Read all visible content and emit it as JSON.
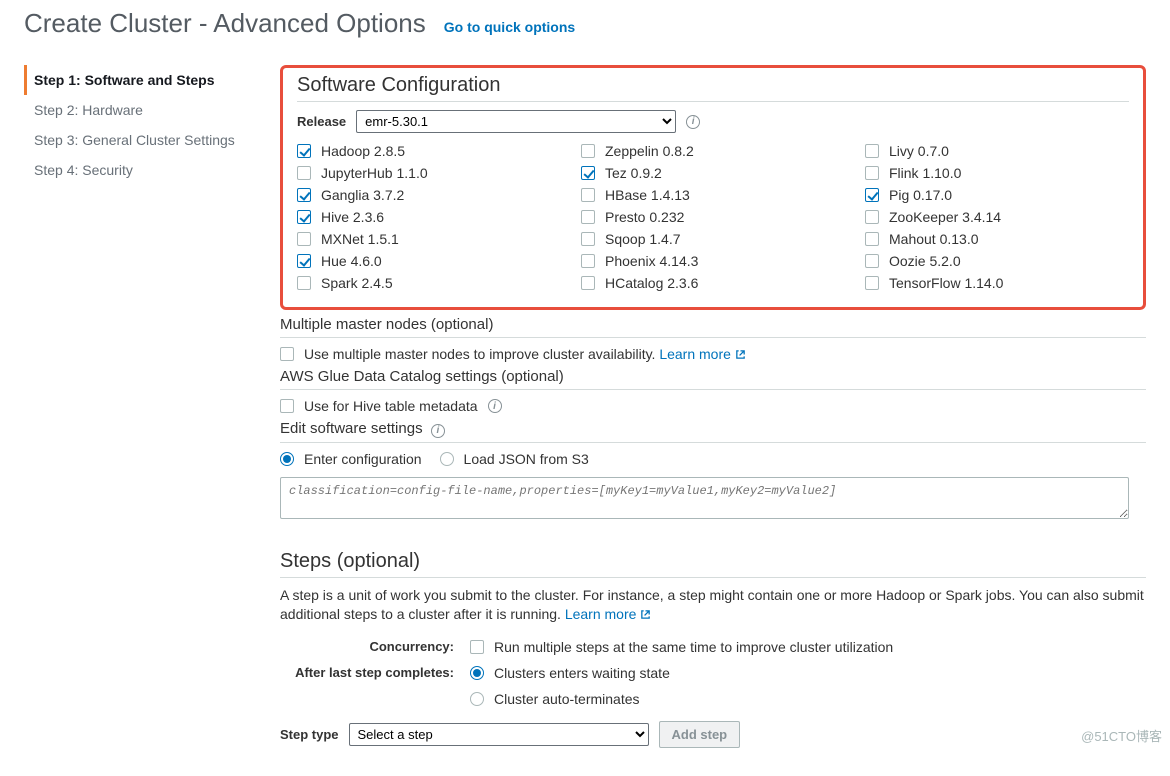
{
  "header": {
    "title": "Create Cluster - Advanced Options",
    "quick_link": "Go to quick options"
  },
  "sidebar": {
    "steps": [
      "Step 1: Software and Steps",
      "Step 2: Hardware",
      "Step 3: General Cluster Settings",
      "Step 4: Security"
    ]
  },
  "software": {
    "heading": "Software Configuration",
    "release_label": "Release",
    "release_value": "emr-5.30.1",
    "columns": [
      [
        {
          "label": "Hadoop 2.8.5",
          "checked": true
        },
        {
          "label": "JupyterHub 1.1.0",
          "checked": false
        },
        {
          "label": "Ganglia 3.7.2",
          "checked": true
        },
        {
          "label": "Hive 2.3.6",
          "checked": true
        },
        {
          "label": "MXNet 1.5.1",
          "checked": false
        },
        {
          "label": "Hue 4.6.0",
          "checked": true
        },
        {
          "label": "Spark 2.4.5",
          "checked": false
        }
      ],
      [
        {
          "label": "Zeppelin 0.8.2",
          "checked": false
        },
        {
          "label": "Tez 0.9.2",
          "checked": true
        },
        {
          "label": "HBase 1.4.13",
          "checked": false
        },
        {
          "label": "Presto 0.232",
          "checked": false
        },
        {
          "label": "Sqoop 1.4.7",
          "checked": false
        },
        {
          "label": "Phoenix 4.14.3",
          "checked": false
        },
        {
          "label": "HCatalog 2.3.6",
          "checked": false
        }
      ],
      [
        {
          "label": "Livy 0.7.0",
          "checked": false
        },
        {
          "label": "Flink 1.10.0",
          "checked": false
        },
        {
          "label": "Pig 0.17.0",
          "checked": true
        },
        {
          "label": "ZooKeeper 3.4.14",
          "checked": false
        },
        {
          "label": "Mahout 0.13.0",
          "checked": false
        },
        {
          "label": "Oozie 5.2.0",
          "checked": false
        },
        {
          "label": "TensorFlow 1.14.0",
          "checked": false
        }
      ]
    ]
  },
  "multi_master": {
    "heading": "Multiple master nodes (optional)",
    "checkbox_label": "Use multiple master nodes to improve cluster availability.",
    "learn_more": "Learn more"
  },
  "glue": {
    "heading": "AWS Glue Data Catalog settings (optional)",
    "checkbox_label": "Use for Hive table metadata"
  },
  "edit_settings": {
    "heading": "Edit software settings",
    "radio_enter": "Enter configuration",
    "radio_load": "Load JSON from S3",
    "placeholder": "classification=config-file-name,properties=[myKey1=myValue1,myKey2=myValue2]"
  },
  "steps_section": {
    "heading": "Steps (optional)",
    "desc_before": "A step is a unit of work you submit to the cluster. For instance, a step might contain one or more Hadoop or Spark jobs. You can also submit additional steps to a cluster after it is running.",
    "learn_more": "Learn more",
    "concurrency_label": "Concurrency:",
    "concurrency_text": "Run multiple steps at the same time to improve cluster utilization",
    "after_last_label": "After last step completes:",
    "after_opt1": "Clusters enters waiting state",
    "after_opt2": "Cluster auto-terminates",
    "step_type_label": "Step type",
    "step_type_value": "Select a step",
    "add_step_btn": "Add step"
  },
  "watermark": "@51CTO博客"
}
